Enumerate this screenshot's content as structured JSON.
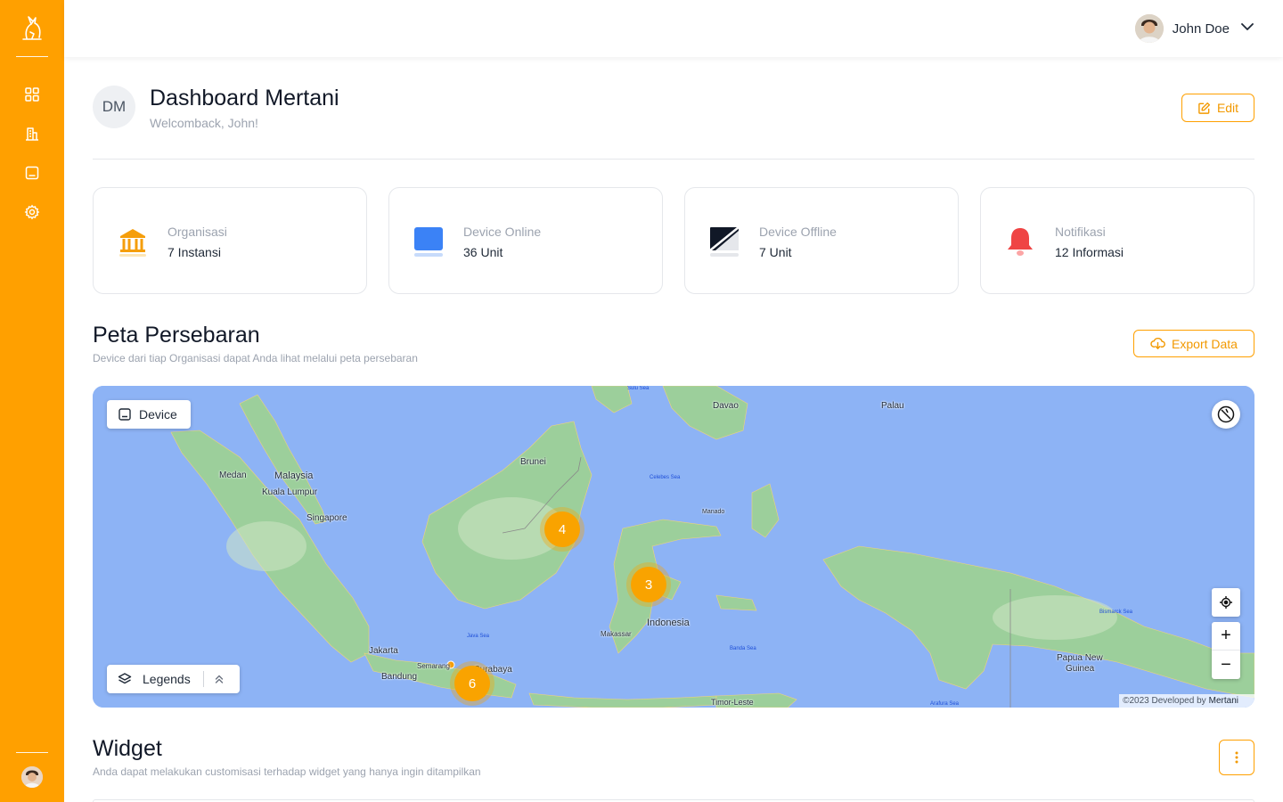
{
  "sidebar": {
    "icons": [
      "dashboard-grid-icon",
      "buildings-icon",
      "device-icon",
      "settings-gear-icon"
    ],
    "accent": "#FFA000"
  },
  "user": {
    "name": "John Doe"
  },
  "header": {
    "badge": "DM",
    "title": "Dashboard Mertani",
    "subtitle": "Welcomback, John!",
    "edit_label": "Edit"
  },
  "stats": [
    {
      "label": "Organisasi",
      "value": "7 Instansi",
      "icon": "bank-icon",
      "color": "#F59E0B"
    },
    {
      "label": "Device Online",
      "value": "36 Unit",
      "icon": "device-online-icon",
      "color": "#3B82F6"
    },
    {
      "label": "Device Offline",
      "value": "7 Unit",
      "icon": "device-offline-icon",
      "color": "#111827"
    },
    {
      "label": "Notifikasi",
      "value": "12 Informasi",
      "icon": "bell-icon",
      "color": "#EF4444"
    }
  ],
  "map_section": {
    "title": "Peta Persebaran",
    "subtitle": "Device dari tiap Organisasi dapat Anda lihat melalui peta persebaran",
    "export_label": "Export Data",
    "device_chip": "Device",
    "legends_chip": "Legends",
    "clusters": [
      "4",
      "3",
      "6"
    ],
    "attribution_prefix": "©2023 Developed by",
    "attribution_brand": "Mertani",
    "labels": {
      "medan": "Medan",
      "malaysia": "Malaysia",
      "kuala_lumpur": "Kuala Lumpur",
      "singapore": "Singapore",
      "brunei": "Brunei",
      "davao": "Davao",
      "palau": "Palau",
      "indonesia": "Indonesia",
      "jakarta": "Jakarta",
      "bandung": "Bandung",
      "semarang": "Semarang",
      "surabaya": "Surabaya",
      "makassar": "Makassar",
      "manado": "Manado",
      "timor_leste": "Timor-Leste",
      "papua_new_guinea_1": "Papua New",
      "papua_new_guinea_2": "Guinea",
      "java_sea": "Java Sea",
      "celebes_sea": "Celebes Sea",
      "banda_sea": "Banda Sea",
      "bismarck_sea": "Bismarck Sea",
      "sulu_sea": "Sulu Sea",
      "arafura_sea": "Arafura Sea"
    }
  },
  "widget_section": {
    "title": "Widget",
    "subtitle": "Anda dapat melakukan customisasi terhadap widget yang hanya ingin ditampilkan"
  }
}
